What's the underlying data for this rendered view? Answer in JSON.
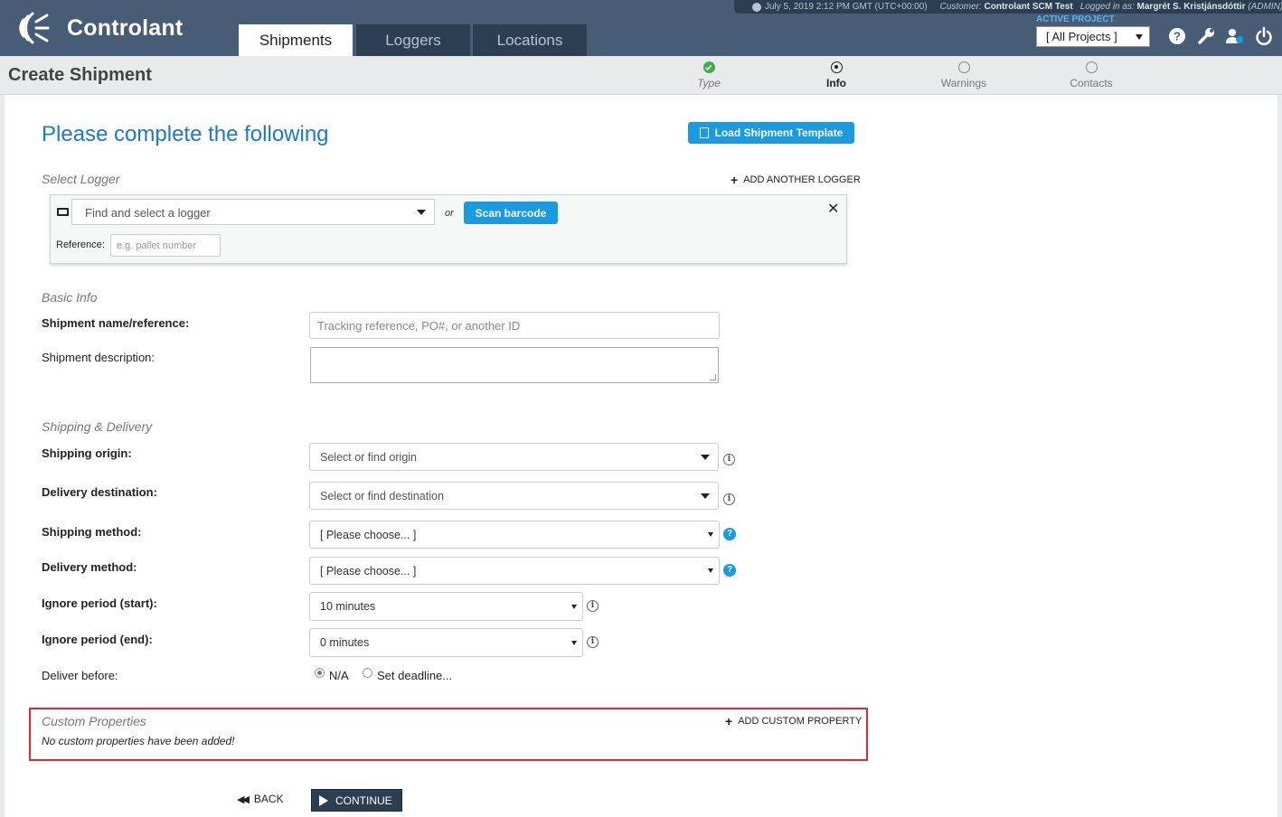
{
  "app": {
    "brand": "Controlant",
    "accent": "#1a9ae0",
    "nav_bg": "#475d76",
    "dark": "#2c3e52"
  },
  "nav": {
    "tabs": [
      {
        "label": "Shipments",
        "active": true
      },
      {
        "label": "Loggers"
      },
      {
        "label": "Locations"
      }
    ]
  },
  "infobar": {
    "datetime": "July 5, 2019 2:12 PM GMT (UTC+00:00)",
    "customer_label": "Customer:",
    "customer": "Controlant SCM Test",
    "logged_label": "Logged in as:",
    "user": "Margrét S. Kristjánsdóttir",
    "role": "(ADMIN)"
  },
  "project": {
    "label": "ACTIVE PROJECT",
    "selected": "[ All Projects ]"
  },
  "icons": [
    "help-icon",
    "wrench-icon",
    "users-icon",
    "power-icon"
  ],
  "page": {
    "title": "Create Shipment"
  },
  "steps": [
    {
      "label": "Type",
      "state": "done"
    },
    {
      "label": "Info",
      "state": "current"
    },
    {
      "label": "Warnings",
      "state": "todo"
    },
    {
      "label": "Contacts",
      "state": "todo"
    }
  ],
  "form": {
    "heading": "Please complete the following",
    "load_template": "Load Shipment Template",
    "select_logger": {
      "title": "Select Logger",
      "add_link": "ADD ANOTHER LOGGER",
      "placeholder": "Find and select a logger",
      "or": "or",
      "scan": "Scan barcode",
      "close": "✕",
      "reference_label": "Reference:",
      "reference_placeholder": "e.g. pallet number"
    },
    "basic": {
      "title": "Basic Info",
      "name_label": "Shipment name/reference:",
      "name_placeholder": "Tracking reference, PO#, or another ID",
      "desc_label": "Shipment description:",
      "desc_value": ""
    },
    "shipping": {
      "title": "Shipping & Delivery",
      "origin_label": "Shipping origin:",
      "origin_placeholder": "Select or find origin",
      "destination_label": "Delivery destination:",
      "destination_placeholder": "Select or find destination",
      "ship_method_label": "Shipping method:",
      "ship_method_value": "[ Please choose... ]",
      "delivery_method_label": "Delivery method:",
      "delivery_method_value": "[ Please choose... ]",
      "ignore_start_label": "Ignore period (start):",
      "ignore_start_value": "10 minutes",
      "ignore_end_label": "Ignore period (end):",
      "ignore_end_value": "0 minutes",
      "deliver_before_label": "Deliver before:",
      "deliver_options": [
        {
          "label": "N/A",
          "checked": true
        },
        {
          "label": "Set deadline...",
          "checked": false
        }
      ]
    },
    "custom": {
      "title": "Custom Properties",
      "add_link": "ADD CUSTOM PROPERTY",
      "empty_text": "No custom properties have been added!"
    },
    "actions": {
      "back": "BACK",
      "continue": "CONTINUE"
    }
  }
}
